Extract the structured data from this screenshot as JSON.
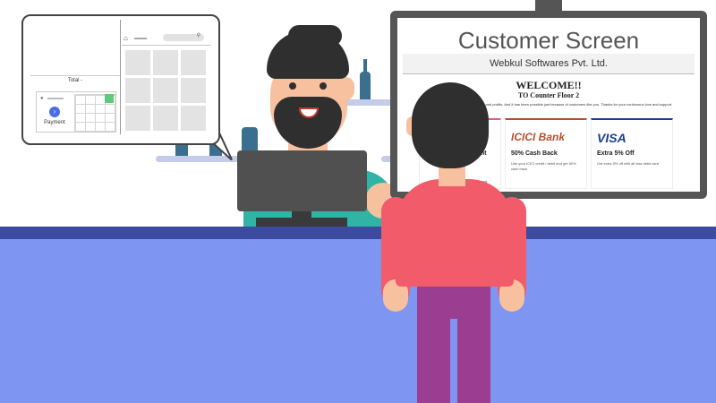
{
  "pos": {
    "total_label": "Total -",
    "payment_label": "Payment",
    "tiles": 9,
    "icons": {
      "user": "user-icon",
      "home": "home-icon",
      "search": "search-icon",
      "pay": "chevron-right-icon"
    }
  },
  "customer_screen": {
    "title": "Customer Screen",
    "company": "Webkul Softwares Pvt. Ltd.",
    "welcome": "WELCOME!!",
    "counter": "TO Counter Floor 2",
    "message": "Our journey has been full of success and profits. And it has been possible just because of customers like you. Thanks for your continuous love and support.",
    "offers": [
      {
        "brand": "",
        "title": "nt",
        "desc": "ebit card",
        "accent": "#e25b86"
      },
      {
        "brand": "ICICI Bank",
        "title": "50% Cash Back",
        "desc": "Use your ICICI credit / debit and get 50% cash back",
        "accent": "#b5502b"
      },
      {
        "brand": "VISA",
        "title": "Extra 5% Off",
        "desc": "Get extra 5% off with all visa debit card",
        "accent": "#1a3f8f"
      }
    ]
  },
  "colors": {
    "counter_top": "#3c4aa0",
    "counter_front": "#7f95f2",
    "customer_shirt": "#f25b6a",
    "customer_pants": "#9b3d90",
    "shopkeeper_shirt": "#2fb4a5"
  }
}
